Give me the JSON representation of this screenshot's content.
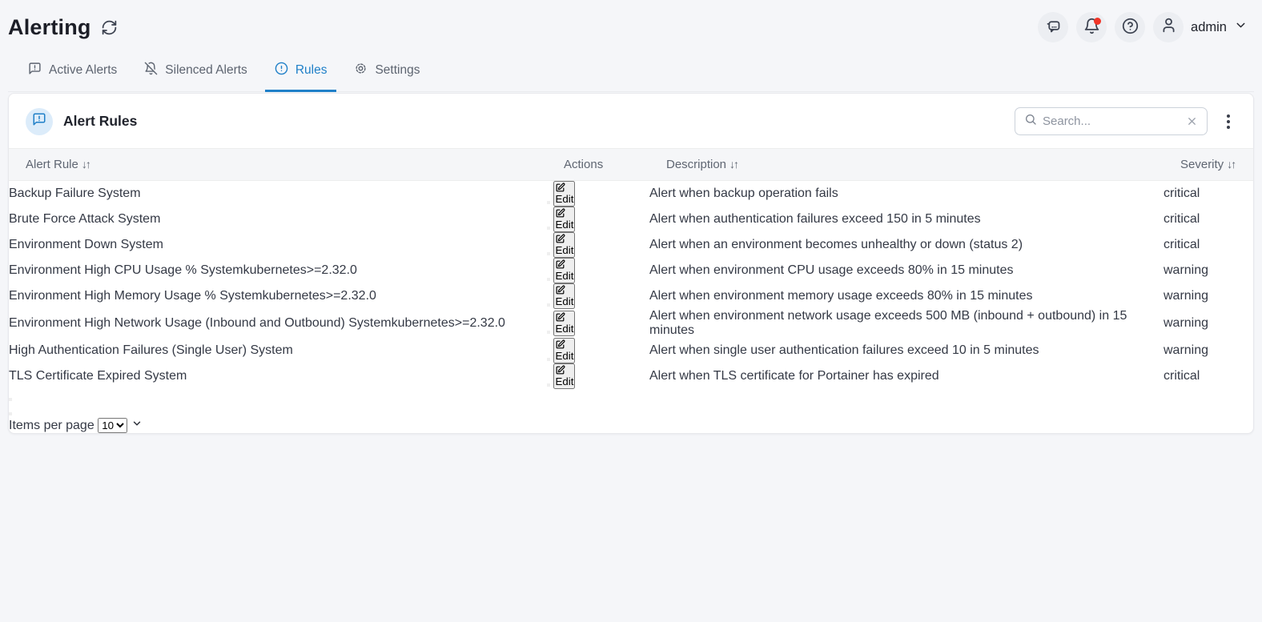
{
  "page": {
    "title": "Alerting"
  },
  "topbar": {
    "user": "admin",
    "icons": [
      "bot-icon",
      "bell-icon",
      "help-icon",
      "user-icon",
      "chevron-down-icon"
    ],
    "notification_dot": true
  },
  "tabs": [
    {
      "label": "Active Alerts",
      "icon": "message-square-warning-icon",
      "active": false
    },
    {
      "label": "Silenced Alerts",
      "icon": "bell-off-icon",
      "active": false
    },
    {
      "label": "Rules",
      "icon": "alert-circle-icon",
      "active": true
    },
    {
      "label": "Settings",
      "icon": "gear-icon",
      "active": false
    }
  ],
  "panel": {
    "title": "Alert Rules",
    "icon": "message-square-warning-icon",
    "search": {
      "placeholder": "Search...",
      "value": ""
    },
    "table": {
      "edit_label": "Edit",
      "headers": {
        "alert_rule": "Alert Rule",
        "actions": "Actions",
        "description": "Description",
        "severity": "Severity"
      },
      "sort": {
        "column": "alert_rule",
        "direction": "desc"
      },
      "rows": [
        {
          "name": "Backup Failure",
          "tags": [
            {
              "label": "System",
              "color": "blue"
            }
          ],
          "enabled": false,
          "edit_enabled": false,
          "description": "Alert when backup operation fails",
          "severity": "critical"
        },
        {
          "name": "Brute Force Attack",
          "tags": [
            {
              "label": "System",
              "color": "blue"
            }
          ],
          "enabled": false,
          "edit_enabled": true,
          "description": "Alert when authentication failures exceed 150 in 5 minutes",
          "severity": "critical"
        },
        {
          "name": "Environment Down",
          "tags": [
            {
              "label": "System",
              "color": "blue"
            }
          ],
          "enabled": true,
          "edit_enabled": false,
          "description": "Alert when an environment becomes unhealthy or down (status 2)",
          "severity": "critical"
        },
        {
          "name": "Environment High CPU Usage %",
          "tags": [
            {
              "label": "System",
              "color": "blue"
            },
            {
              "label": "kubernetes",
              "color": "green"
            },
            {
              "label": ">=2.32.0",
              "color": "orange"
            }
          ],
          "enabled": true,
          "edit_enabled": true,
          "description": "Alert when environment CPU usage exceeds 80% in 15 minutes",
          "severity": "warning"
        },
        {
          "name": "Environment High Memory Usage %",
          "tags": [
            {
              "label": "System",
              "color": "blue"
            },
            {
              "label": "kubernetes",
              "color": "green"
            },
            {
              "label": ">=2.32.0",
              "color": "orange"
            }
          ],
          "enabled": true,
          "edit_enabled": true,
          "description": "Alert when environment memory usage exceeds 80% in 15 minutes",
          "severity": "warning"
        },
        {
          "name": "Environment High Network Usage (Inbound and Outbound)",
          "tags": [
            {
              "label": "System",
              "color": "blue"
            },
            {
              "label": "kubernetes",
              "color": "green"
            },
            {
              "label": ">=2.32.0",
              "color": "orange"
            }
          ],
          "enabled": false,
          "edit_enabled": true,
          "description": "Alert when environment network usage exceeds 500 MB (inbound + outbound) in 15 minutes",
          "severity": "warning"
        },
        {
          "name": "High Authentication Failures (Single User)",
          "tags": [
            {
              "label": "System",
              "color": "blue"
            }
          ],
          "enabled": false,
          "edit_enabled": true,
          "description": "Alert when single user authentication failures exceed 10 in 5 minutes",
          "severity": "warning"
        },
        {
          "name": "TLS Certificate Expired",
          "tags": [
            {
              "label": "System",
              "color": "blue"
            }
          ],
          "enabled": false,
          "edit_enabled": false,
          "description": "Alert when TLS certificate for Portainer has expired",
          "severity": "critical"
        }
      ]
    },
    "footer": {
      "items_per_page_label": "Items per page",
      "items_per_page_value": "10"
    }
  },
  "colors": {
    "accent_blue": "#2080c8",
    "toggle_on": "#1e90d2",
    "toggle_off": "#a6aebf",
    "edit_button_dark": "#2c2c34",
    "notification_red": "#f03528",
    "tag_blue_text": "#2389cd",
    "tag_green_text": "#2f9e62",
    "tag_orange_text": "#e0731d",
    "header_row_bg": "#f5f6f8"
  }
}
